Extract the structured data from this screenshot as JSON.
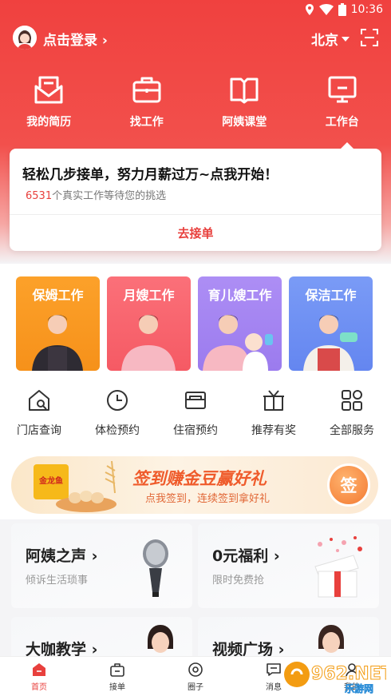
{
  "status": {
    "time": "10:36"
  },
  "header": {
    "login": "点击登录",
    "city": "北京"
  },
  "quick_nav": [
    {
      "label": "我的简历",
      "icon": "resume-icon"
    },
    {
      "label": "找工作",
      "icon": "briefcase-icon"
    },
    {
      "label": "阿姨课堂",
      "icon": "book-icon"
    },
    {
      "label": "工作台",
      "icon": "workbench-icon"
    }
  ],
  "promo_card": {
    "title": "轻松几步接单，努力月薪过万~点我开始！",
    "count": "6531",
    "sub_suffix": "个真实工作等待您的挑选",
    "button": "去接单"
  },
  "jobs": [
    {
      "label": "保姆工作",
      "color": "#f89a1a"
    },
    {
      "label": "月嫂工作",
      "color": "#f7636c"
    },
    {
      "label": "育儿嫂工作",
      "color": "#a486f0"
    },
    {
      "label": "保洁工作",
      "color": "#6a8df2"
    }
  ],
  "services": [
    {
      "label": "门店查询",
      "icon": "store-search-icon"
    },
    {
      "label": "体检预约",
      "icon": "clock-icon"
    },
    {
      "label": "住宿预约",
      "icon": "bed-icon"
    },
    {
      "label": "推荐有奖",
      "icon": "gift-icon"
    },
    {
      "label": "全部服务",
      "icon": "grid-icon"
    }
  ],
  "banner": {
    "title": "签到赚金豆赢好礼",
    "sub": "点我签到，连续签到拿好礼",
    "button": "签",
    "product_label": "金龙鱼"
  },
  "features": [
    {
      "title": "阿姨之声",
      "sub": "倾诉生活琐事",
      "icon": "microphone-icon"
    },
    {
      "title": "0元福利",
      "sub": "限时免费抢",
      "icon": "gift-box-icon"
    },
    {
      "title": "大咖教学",
      "sub": "",
      "icon": "teacher-avatar"
    },
    {
      "title": "视频广场",
      "sub": "",
      "icon": "presenter-avatar"
    }
  ],
  "tabs": [
    {
      "label": "首页",
      "icon": "home-icon",
      "active": true
    },
    {
      "label": "接单",
      "icon": "order-icon",
      "active": false
    },
    {
      "label": "圈子",
      "icon": "circle-icon",
      "active": false
    },
    {
      "label": "消息",
      "icon": "message-icon",
      "active": false
    },
    {
      "label": "我的",
      "icon": "profile-icon",
      "active": false
    }
  ],
  "watermark": {
    "brand": "962.NET",
    "sub": "乐游网"
  },
  "colors": {
    "primary": "#e8403d",
    "hero": "#f0413f"
  }
}
